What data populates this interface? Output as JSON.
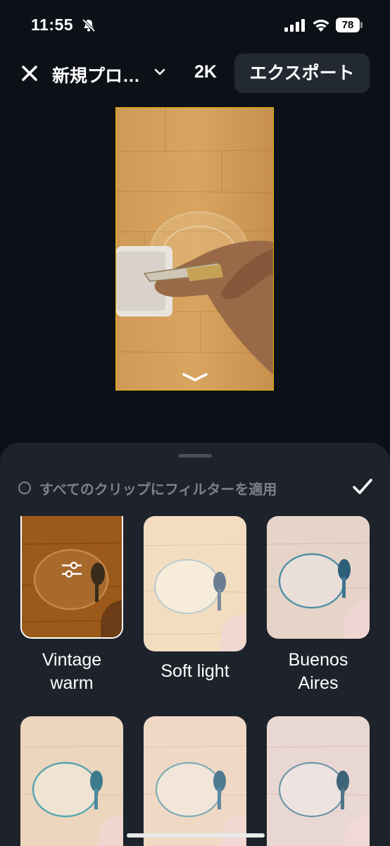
{
  "status_bar": {
    "time": "11:55",
    "battery": "78"
  },
  "header": {
    "project_title": "新規プロ…",
    "resolution": "2K",
    "export_label": "エクスポート"
  },
  "sheet": {
    "apply_all_label": "すべてのクリップにフィルターを適用",
    "filters": [
      {
        "name": "Vintage warm",
        "selected": true
      },
      {
        "name": "Soft light",
        "selected": false
      },
      {
        "name": "Buenos Aires",
        "selected": false
      }
    ]
  },
  "colors": {
    "accent": "#e5b400",
    "background": "#0d1117",
    "sheet": "#1e232b"
  }
}
